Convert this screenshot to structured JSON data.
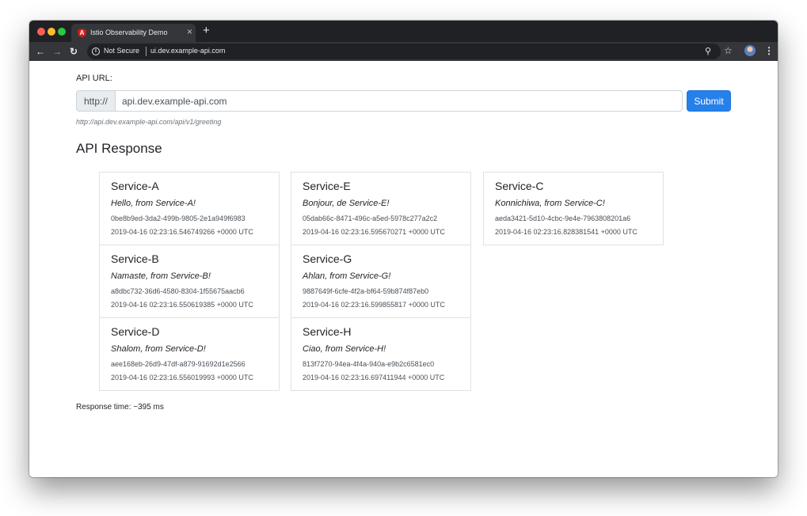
{
  "browser": {
    "tab_title": "Istio Observability Demo",
    "tab_favicon_letter": "A",
    "tab_close": "×",
    "new_tab": "+",
    "security_label": "Not Secure",
    "address": "ui.dev.example-api.com",
    "icons": {
      "back": "arrow-left",
      "forward": "arrow-right",
      "reload": "reload",
      "info": "info-circle",
      "zoom": "magnifier",
      "bookmark": "star",
      "menu": "kebab"
    }
  },
  "form": {
    "label": "API URL:",
    "prefix": "http://",
    "value": "api.dev.example-api.com",
    "submit_label": "Submit",
    "hint": "http://api.dev.example-api.com/api/v1/greeting"
  },
  "response": {
    "heading": "API Response",
    "cards": [
      {
        "service": "Service-A",
        "message": "Hello, from Service-A!",
        "id": "0be8b9ed-3da2-499b-9805-2e1a949f6983",
        "time": "2019-04-16 02:23:16.546749266 +0000 UTC"
      },
      {
        "service": "Service-B",
        "message": "Namaste, from Service-B!",
        "id": "a8dbc732-36d6-4580-8304-1f55675aacb6",
        "time": "2019-04-16 02:23:16.550619385 +0000 UTC"
      },
      {
        "service": "Service-D",
        "message": "Shalom, from Service-D!",
        "id": "aee168eb-26d9-47df-a879-91692d1e2566",
        "time": "2019-04-16 02:23:16.556019993 +0000 UTC"
      },
      {
        "service": "Service-E",
        "message": "Bonjour, de Service-E!",
        "id": "05dab66c-8471-496c-a5ed-5978c277a2c2",
        "time": "2019-04-16 02:23:16.595670271 +0000 UTC"
      },
      {
        "service": "Service-G",
        "message": "Ahlan, from Service-G!",
        "id": "9887649f-6cfe-4f2a-bf64-59b874f87eb0",
        "time": "2019-04-16 02:23:16.599855817 +0000 UTC"
      },
      {
        "service": "Service-H",
        "message": "Ciao, from Service-H!",
        "id": "813f7270-94ea-4f4a-940a-e9b2c6581ec0",
        "time": "2019-04-16 02:23:16.697411944 +0000 UTC"
      },
      {
        "service": "Service-C",
        "message": "Konnichiwa, from Service-C!",
        "id": "aeda3421-5d10-4cbc-9e4e-7963808201a6",
        "time": "2019-04-16 02:23:16.828381541 +0000 UTC"
      }
    ],
    "time_label": "Response time: ~395 ms"
  },
  "colors": {
    "accent": "#2680e9",
    "tabstrip": "#202124",
    "toolbar": "#35363a"
  }
}
